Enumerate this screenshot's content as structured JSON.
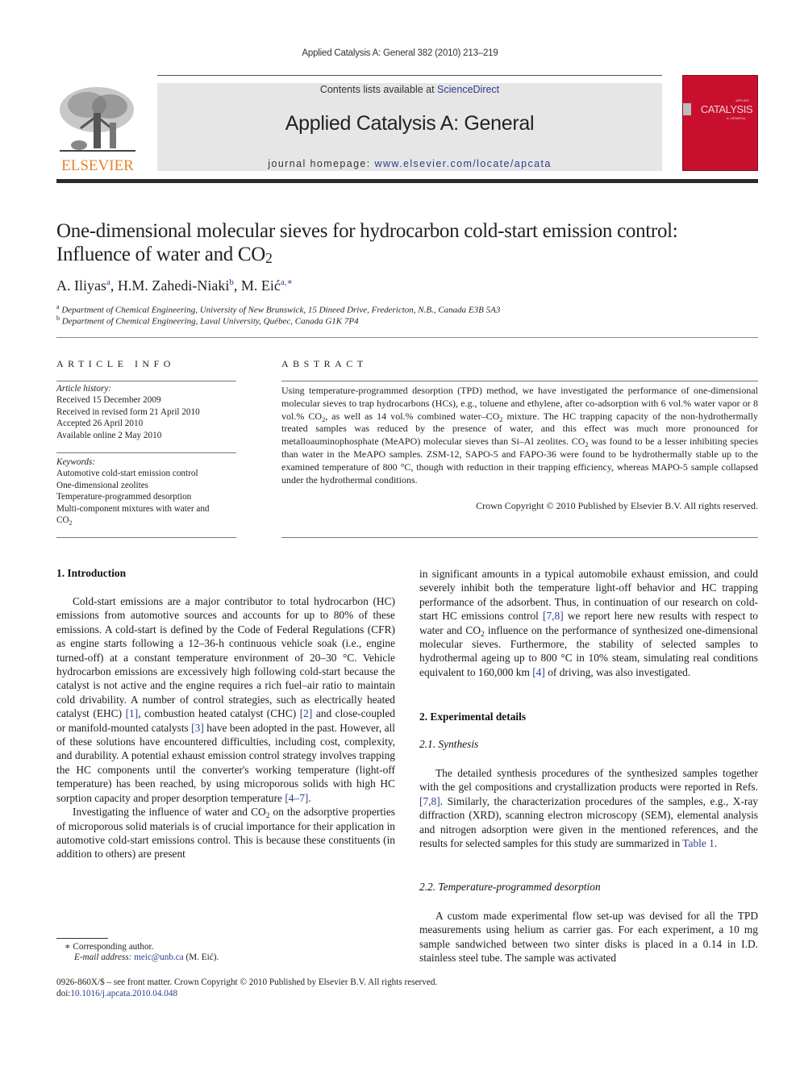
{
  "running_head": "Applied Catalysis A: General 382 (2010) 213–219",
  "masthead": {
    "publisher_logo_text": "ELSEVIER",
    "contents_prefix": "Contents lists available at ",
    "contents_link": "ScienceDirect",
    "journal_title": "Applied Catalysis A: General",
    "homepage_prefix": "journal homepage: ",
    "homepage_link": "www.elsevier.com/locate/apcata",
    "cover": {
      "title": "CATALYSIS",
      "kicker": "APPLIED",
      "subtitle": "A: GENERAL",
      "color": "#c8102e"
    }
  },
  "article": {
    "title_line1": "One-dimensional molecular sieves for hydrocarbon cold-start emission control:",
    "title_line2_prefix": "Influence of water and CO",
    "title_line2_sub": "2",
    "authors": [
      {
        "name": "A. Iliyas",
        "marks": "a"
      },
      {
        "name": "H.M. Zahedi-Niaki",
        "marks": "b"
      },
      {
        "name": "M. Eić",
        "marks": "a,∗"
      }
    ],
    "affiliations": [
      {
        "mark": "a",
        "text": "Department of Chemical Engineering, University of New Brunswick, 15 Dineed Drive, Fredericton, N.B., Canada E3B 5A3"
      },
      {
        "mark": "b",
        "text": "Department of Chemical Engineering, Laval University, Québec, Canada G1K 7P4"
      }
    ]
  },
  "article_info": {
    "heading": "ARTICLE INFO",
    "history_label": "Article history:",
    "history": [
      "Received 15 December 2009",
      "Received in revised form 21 April 2010",
      "Accepted 26 April 2010",
      "Available online 2 May 2010"
    ],
    "keywords_label": "Keywords:",
    "keywords": [
      "Automotive cold-start emission control",
      "One-dimensional zeolites",
      "Temperature-programmed desorption",
      "Multi-component mixtures with water and"
    ],
    "keywords_last_prefix": "CO",
    "keywords_last_sub": "2"
  },
  "abstract": {
    "heading": "ABSTRACT",
    "p1": "Using temperature-programmed desorption (TPD) method, we have investigated the performance of one-dimensional molecular sieves to trap hydrocarbons (HCs), e.g., toluene and ethylene, after co-adsorption with 6 vol.% water vapor or 8 vol.% CO",
    "p2": ", as well as 14 vol.% combined water–CO",
    "p3": " mixture. The HC trapping capacity of the non-hydrothermally treated samples was reduced by the presence of water, and this effect was much more pronounced for metalloauminophosphate (MeAPO) molecular sieves than Si–Al zeolites. CO",
    "p4": " was found to be a lesser inhibiting species than water in the MeAPO samples. ZSM-12, SAPO-5 and FAPO-36 were found to be hydrothermally stable up to the examined temperature of 800 °C, though with reduction in their trapping efficiency, whereas MAPO-5 sample collapsed under the hydrothermal conditions.",
    "sub": "2",
    "copyright": "Crown Copyright © 2010 Published by Elsevier B.V. All rights reserved."
  },
  "body": {
    "sec1_title": "1.  Introduction",
    "sec1_p1_a": "Cold-start emissions are a major contributor to total hydrocarbon (HC) emissions from automotive sources and accounts for up to 80% of these emissions. A cold-start is defined by the Code of Federal Regulations (CFR) as engine starts following a 12–36-h continuous vehicle soak (i.e., engine turned-off) at a constant temperature environment of 20–30 °C. Vehicle hydrocarbon emissions are excessively high following cold-start because the catalyst is not active and the engine requires a rich fuel–air ratio to maintain cold drivability. A number of control strategies, such as electrically heated catalyst (EHC) ",
    "ref1": "[1]",
    "sec1_p1_b": ", combustion heated catalyst (CHC) ",
    "ref2": "[2]",
    "sec1_p1_c": " and close-coupled or manifold-mounted catalysts ",
    "ref3": "[3]",
    "sec1_p1_d": " have been adopted in the past. However, all of these solutions have encountered difficulties, including cost, complexity, and durability. A potential exhaust emission control strategy involves trapping the HC components until the converter's working temperature (light-off temperature) has been reached, by using microporous solids with high HC sorption capacity and proper desorption temperature ",
    "ref4_7": "[4–7]",
    "sec1_p1_e": ".",
    "sec1_p2_a": "Investigating the influence of water and CO",
    "sec1_p2_b": " on the adsorptive properties of microporous solid materials is of crucial importance for their application in automotive cold-start emissions control. This is because these constituents (in addition to others) are present",
    "right_p1_a": "in significant amounts in a typical automobile exhaust emission, and could severely inhibit both the temperature light-off behavior and HC trapping performance of the adsorbent. Thus, in continuation of our research on cold-start HC emissions control ",
    "ref7_8": "[7,8]",
    "right_p1_b": " we report here new results with respect to water and CO",
    "right_p1_c": " influence on the performance of synthesized one-dimensional molecular sieves. Furthermore, the stability of selected samples to hydrothermal ageing up to 800 °C in 10% steam, simulating real conditions equivalent to 160,000 km ",
    "ref4": "[4]",
    "right_p1_d": " of driving, was also investigated.",
    "sec2_title": "2.  Experimental details",
    "sec21_title": "2.1.  Synthesis",
    "sec21_p_a": "The detailed synthesis procedures of the synthesized samples together with the gel compositions and crystallization products were reported in Refs. ",
    "ref7_8b": "[7,8]",
    "sec21_p_b": ". Similarly, the characterization procedures of the samples, e.g., X-ray diffraction (XRD), scanning electron microscopy (SEM), elemental analysis and nitrogen adsorption were given in the mentioned references, and the results for selected samples for this study are summarized in ",
    "table_ref": "Table 1",
    "sec21_p_c": ".",
    "sec22_title": "2.2.  Temperature-programmed desorption",
    "sec22_p": "A custom made experimental flow set-up was devised for all the TPD measurements using helium as carrier gas. For each experiment, a 10 mg sample sandwiched between two sinter disks is placed in a 0.14 in I.D. stainless steel tube. The sample was activated",
    "sub": "2"
  },
  "footer": {
    "corr_mark": "∗",
    "corr_text": " Corresponding author.",
    "email_label": "E-mail address: ",
    "email": "meic@unb.ca",
    "email_suffix": " (M. Eić).",
    "issn_line": "0926-860X/$ – see front matter. Crown Copyright © 2010 Published by Elsevier B.V. All rights reserved.",
    "doi_prefix": "doi:",
    "doi": "10.1016/j.apcata.2010.04.048"
  },
  "colors": {
    "link": "#2a3f8f",
    "elsevier_orange": "#e8822a",
    "band_gray": "#e6e6e6",
    "cover_red": "#c8102e"
  }
}
